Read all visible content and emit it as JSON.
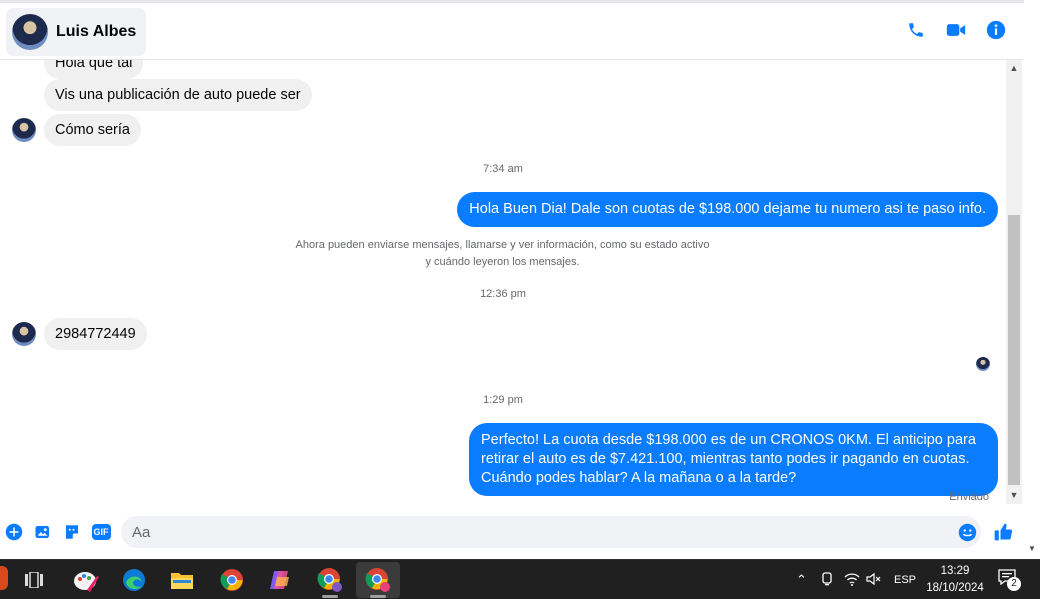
{
  "contact": {
    "name": "Luis Albes"
  },
  "colors": {
    "accent": "#0a7cff",
    "incoming": "#f0f0f0",
    "taskbar": "#202020"
  },
  "header": {
    "icons": [
      "phone-icon",
      "video-call-icon",
      "info-icon"
    ]
  },
  "messages": {
    "in_1": "Hola que tal",
    "in_2": "Vis una publicación de auto puede ser",
    "in_3": "Cómo sería",
    "time_1": "7:34 am",
    "out_1": "Hola Buen Dia! Dale son cuotas de $198.000 dejame tu numero asi te paso info.",
    "notice_line1": "Ahora pueden enviarse mensajes, llamarse y ver información, como su estado activo",
    "notice_line2": "y cuándo leyeron los mensajes.",
    "time_2": "12:36 pm",
    "in_4": "2984772449",
    "time_3": "1:29 pm",
    "out_2": "Perfecto! La cuota desde $198.000 es de un CRONOS 0KM. El anticipo para retirar el auto es de $7.421.100, mientras tanto podes ir pagando en cuotas. Cuándo podes hablar? A la mañana o a la tarde?",
    "status": "Enviado"
  },
  "composer": {
    "placeholder": "Aa",
    "gif_label": "GIF",
    "icons": [
      "plus-icon",
      "image-icon",
      "sticker-icon",
      "gif-icon",
      "emoji-icon",
      "like-icon"
    ]
  },
  "taskbar": {
    "apps": [
      "task-view",
      "paint",
      "edge",
      "file-explorer",
      "chrome",
      "copilot",
      "chrome-profile-1",
      "chrome-profile-2"
    ],
    "lang": "ESP",
    "time": "13:29",
    "date": "18/10/2024",
    "notifications": "2"
  }
}
